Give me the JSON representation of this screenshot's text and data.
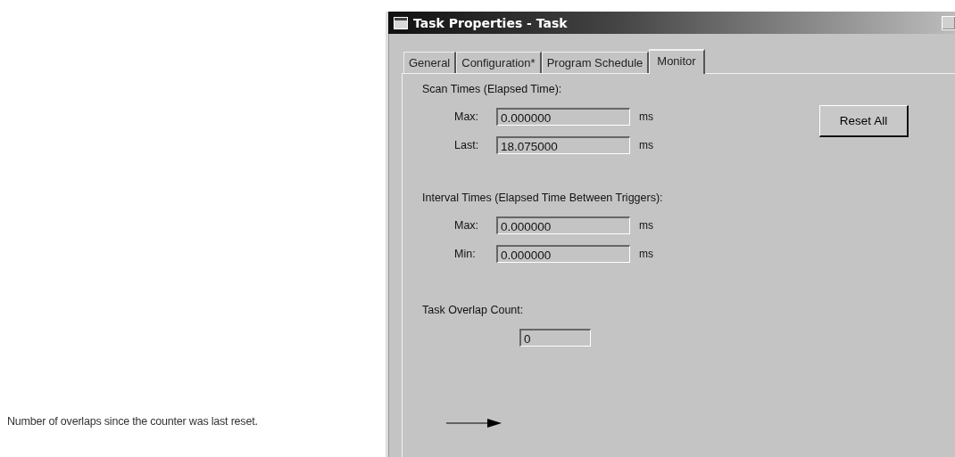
{
  "callout": {
    "text": "Number of overlaps since the counter was last reset."
  },
  "window": {
    "title": "Task Properties - Task"
  },
  "tabs": [
    {
      "label": "General",
      "selected": false
    },
    {
      "label": "Configuration*",
      "selected": false
    },
    {
      "label": "Program Schedule",
      "selected": false
    },
    {
      "label": "Monitor",
      "selected": true
    }
  ],
  "scan_times": {
    "heading": "Scan Times (Elapsed Time):",
    "rows": [
      {
        "label": "Max:",
        "value": "0.000000",
        "unit": "ms"
      },
      {
        "label": "Last:",
        "value": "18.075000",
        "unit": "ms"
      }
    ],
    "button": "Reset All"
  },
  "interval_times": {
    "heading": "Interval Times (Elapsed Time Between Triggers):",
    "rows": [
      {
        "label": "Max:",
        "value": "0.000000",
        "unit": "ms"
      },
      {
        "label": "Min:",
        "value": "0.000000",
        "unit": "ms"
      }
    ]
  },
  "overlap": {
    "heading": "Task Overlap Count:",
    "value": "0"
  }
}
